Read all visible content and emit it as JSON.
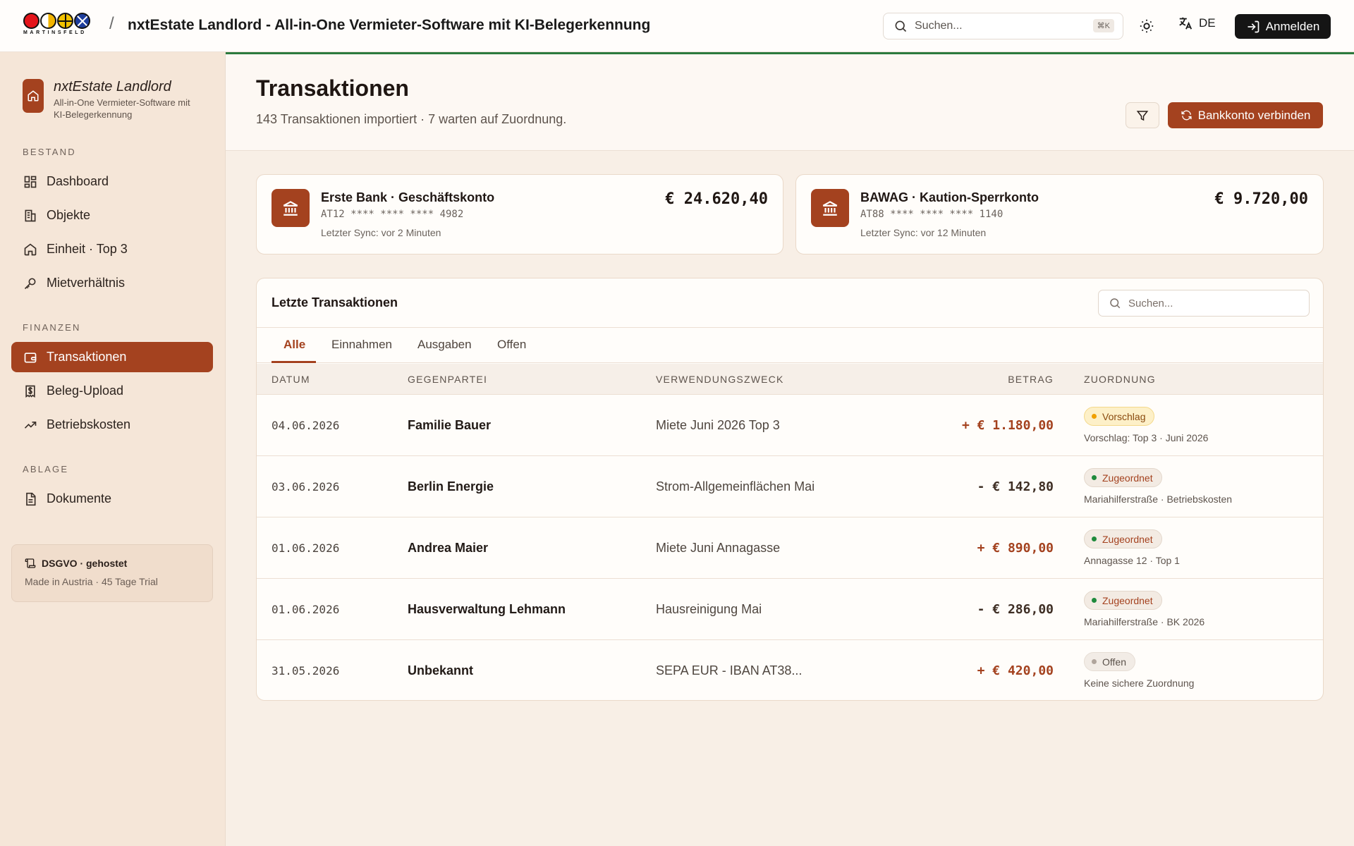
{
  "topbar": {
    "logo_word": "MARTINSFELD",
    "separator": "/",
    "title": "nxtEstate Landlord - All-in-One Vermieter-Software mit KI-Belegerkennung",
    "search_placeholder": "Suchen...",
    "search_shortcut": "⌘K",
    "theme_icon": "sun-icon",
    "language": "DE",
    "signin_label": "Anmelden"
  },
  "sidebar": {
    "brand_name": "nxtEstate Landlord",
    "brand_sub": "All-in-One Vermieter-Software mit KI-Belegerkennung",
    "sections": [
      {
        "label": "BESTAND",
        "items": [
          {
            "label": "Dashboard",
            "icon": "dashboard-icon"
          },
          {
            "label": "Objekte",
            "icon": "building-icon"
          },
          {
            "label": "Einheit · Top 3",
            "icon": "home-icon"
          },
          {
            "label": "Mietverhältnis",
            "icon": "key-icon"
          }
        ]
      },
      {
        "label": "FINANZEN",
        "items": [
          {
            "label": "Transaktionen",
            "icon": "wallet-icon",
            "active": true
          },
          {
            "label": "Beleg-Upload",
            "icon": "receipt-icon"
          },
          {
            "label": "Betriebskosten",
            "icon": "trend-icon"
          }
        ]
      },
      {
        "label": "ABLAGE",
        "items": [
          {
            "label": "Dokumente",
            "icon": "document-icon"
          }
        ]
      }
    ],
    "footer_title": "DSGVO · gehostet",
    "footer_sub": "Made in Austria · 45 Tage Trial"
  },
  "header": {
    "title": "Transaktionen",
    "subtitle": "143 Transaktionen importiert · 7 warten auf Zuordnung.",
    "connect_label": "Bankkonto verbinden"
  },
  "accounts": [
    {
      "name": "Erste Bank · Geschäftskonto",
      "iban": "AT12 **** **** **** 4982",
      "sync": "Letzter Sync: vor 2 Minuten",
      "balance": "€ 24.620,40"
    },
    {
      "name": "BAWAG · Kaution-Sperrkonto",
      "iban": "AT88 **** **** **** 1140",
      "sync": "Letzter Sync: vor 12 Minuten",
      "balance": "€ 9.720,00"
    }
  ],
  "transactions": {
    "title": "Letzte Transaktionen",
    "search_placeholder": "Suchen...",
    "tabs": [
      "Alle",
      "Einnahmen",
      "Ausgaben",
      "Offen"
    ],
    "columns": [
      "DATUM",
      "GEGENPARTEI",
      "VERWENDUNGSZWECK",
      "BETRAG",
      "ZUORDNUNG"
    ],
    "rows": [
      {
        "date": "04.06.2026",
        "party": "Familie Bauer",
        "purpose": "Miete Juni 2026 Top 3",
        "amount": "+ € 1.180,00",
        "status": "Vorschlag",
        "note": "Vorschlag: Top 3 · Juni 2026"
      },
      {
        "date": "03.06.2026",
        "party": "Berlin Energie",
        "purpose": "Strom-Allgemeinflächen Mai",
        "amount": "- € 142,80",
        "status": "Zugeordnet",
        "note": "Mariahilferstraße · Betriebskosten"
      },
      {
        "date": "01.06.2026",
        "party": "Andrea Maier",
        "purpose": "Miete Juni Annagasse",
        "amount": "+ € 890,00",
        "status": "Zugeordnet",
        "note": "Annagasse 12 · Top 1"
      },
      {
        "date": "01.06.2026",
        "party": "Hausverwaltung Lehmann",
        "purpose": "Hausreinigung Mai",
        "amount": "- € 286,00",
        "status": "Zugeordnet",
        "note": "Mariahilferstraße · BK 2026"
      },
      {
        "date": "31.05.2026",
        "party": "Unbekannt",
        "purpose": "SEPA EUR - IBAN AT38...",
        "amount": "+ € 420,00",
        "status": "Offen",
        "note": "Keine sichere Zuordnung"
      }
    ]
  },
  "colors": {
    "accent": "#a4421f",
    "success": "#1f8a3c",
    "warning": "#f0a000"
  }
}
